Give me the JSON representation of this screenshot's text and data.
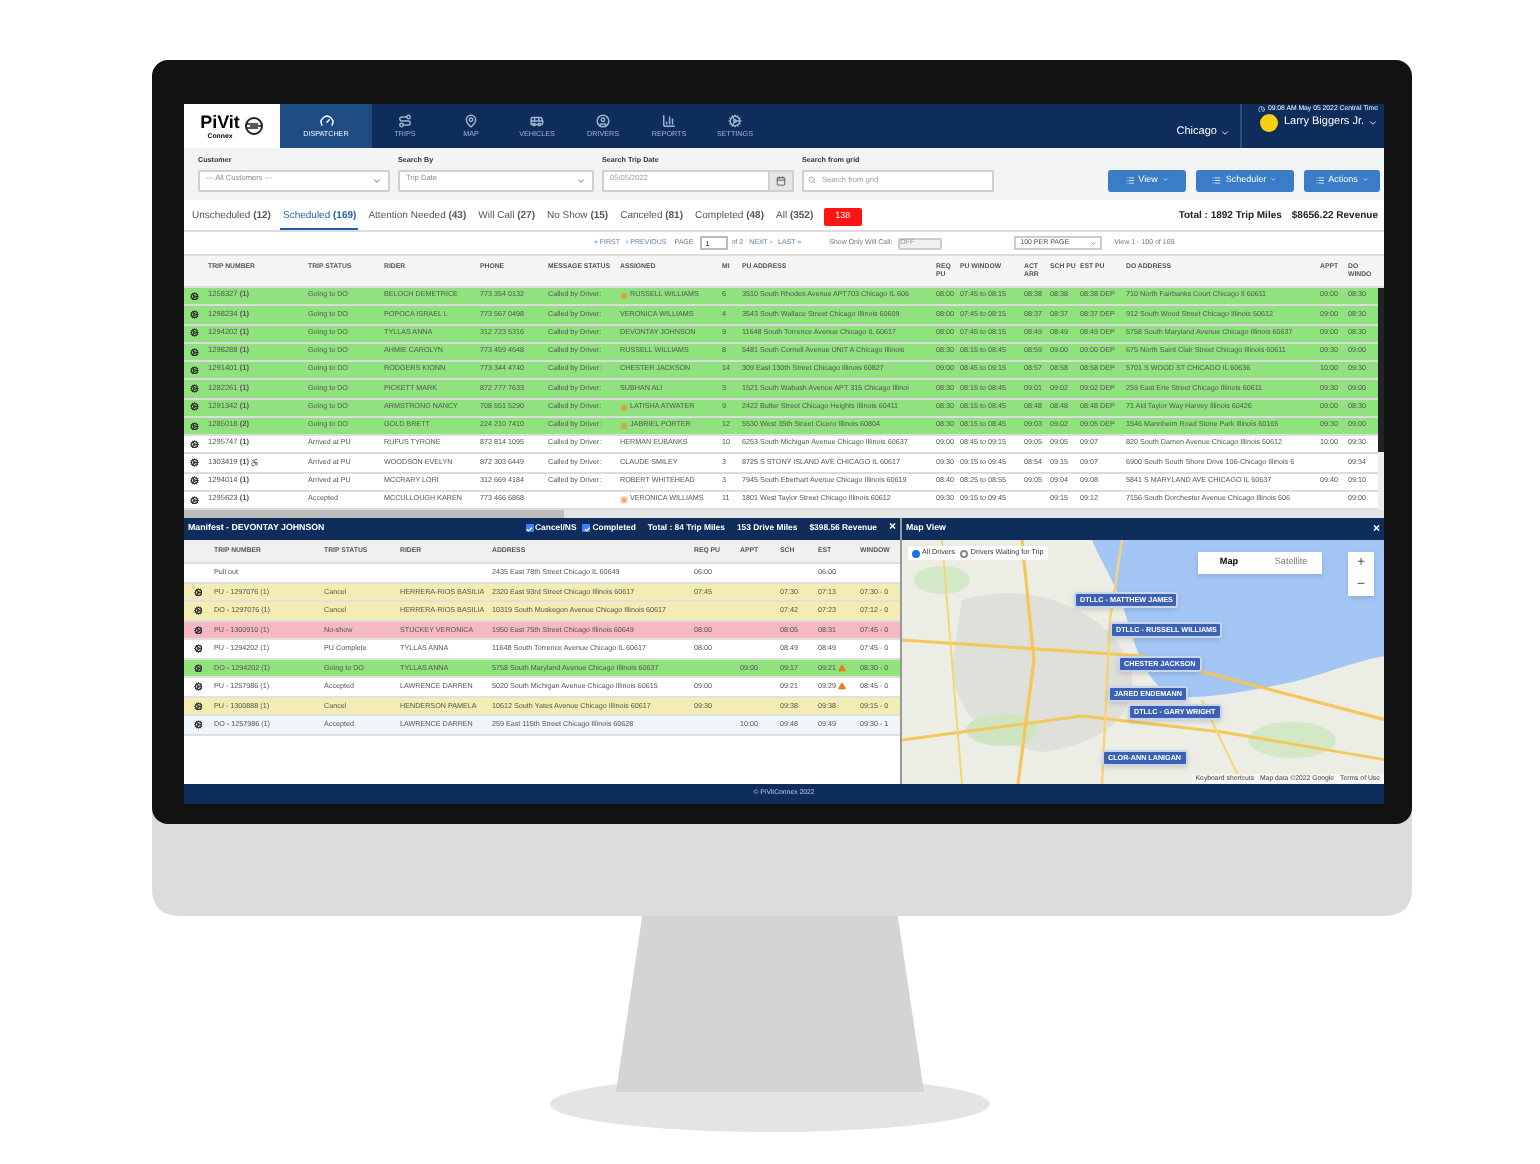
{
  "header": {
    "logo": {
      "name": "PiVit",
      "sub": "Connex"
    },
    "nav": [
      {
        "label": "DISPATCHER",
        "selected": true
      },
      {
        "label": "TRIPS",
        "selected": false
      },
      {
        "label": "MAP",
        "selected": false
      },
      {
        "label": "VEHICLES",
        "selected": false
      },
      {
        "label": "DRIVERS",
        "selected": false
      },
      {
        "label": "REPORTS",
        "selected": false
      },
      {
        "label": "SETTINGS",
        "selected": false
      }
    ],
    "datetime": "09:08 AM May 05 2022 Central Time",
    "city": "Chicago",
    "user": "Larry Biggers Jr."
  },
  "filters": [
    {
      "kind": "select",
      "label": "Customer",
      "value": "--- All Customers ---"
    },
    {
      "kind": "select",
      "label": "Search By",
      "value": "Trip Date"
    },
    {
      "kind": "date",
      "label": "Search Trip Date",
      "value": "05/05/2022"
    },
    {
      "kind": "search",
      "label": "Search from grid",
      "placeholder": "Search from grid"
    }
  ],
  "actions": [
    "View",
    "Scheduler",
    "Actions"
  ],
  "tabs": [
    {
      "label": "Unscheduled **(12)**",
      "selected": false
    },
    {
      "label": "Scheduled **(169)**",
      "selected": true
    },
    {
      "label": "Attention Needed **(43)**",
      "selected": false
    },
    {
      "label": "Will Call **(27)**",
      "selected": false
    },
    {
      "label": "No Show **(15)**",
      "selected": false
    },
    {
      "label": "Canceled **(81)**",
      "selected": false
    },
    {
      "label": "Completed **(48)**",
      "selected": false
    },
    {
      "label": "All **(352)**",
      "selected": false
    }
  ],
  "alert_badge": "138",
  "total_miles": "Total : 1892 Trip Miles",
  "total_revenue": "$8656.22 Revenue",
  "pager": {
    "first": "« FIRST",
    "previous": "‹ PREVIOUS",
    "page_label": "PAGE",
    "page": "1",
    "of": "of 2",
    "next": "NEXT ›",
    "last": "LAST »",
    "will_call_label": "Show Only Will Call:",
    "will_call_toggle": "OFF",
    "will_call_on": false,
    "per_page": "100 PER PAGE",
    "view": "View 1 - 100 of 169"
  },
  "trips": {
    "columns": [
      "TRIP NUMBER",
      "TRIP STATUS",
      "RIDER",
      "PHONE",
      "MESSAGE STATUS",
      "ASSIGNED",
      "MI",
      "PU ADDRESS",
      "REQ PU",
      "PU WINDOW",
      "ACT ARR",
      "SCH PU",
      "EST PU",
      "DO ADDRESS",
      "APPT",
      "DO WINDO"
    ],
    "rows": [
      {
        "highlighted": true,
        "wheelchair": false,
        "assigned_flag": true,
        "trip": "1258327 **(1)**",
        "status": "Going to DO",
        "rider": "BELOCH DEMETRICE",
        "phone": "773 354 0132",
        "message": "Called by Driver:",
        "assigned": "RUSSELL WILLIAMS",
        "mi": "6",
        "pu_address": "3510 South Rhodes Avenue APT703 Chicago IL 606",
        "req_pu": "08:00",
        "pu_window": "07:45 to 08:15",
        "act_arr": "08:38",
        "sch_pu": "08:38",
        "est_pu": "08:38 DEP",
        "do_address": "710 North Fairbanks Court Chicago Il 60611",
        "appt": "09:00",
        "do_window": "08:30"
      },
      {
        "highlighted": true,
        "wheelchair": false,
        "assigned_flag": false,
        "trip": "1298234 **(1)**",
        "status": "Going to DO",
        "rider": "POPOCA ISRAEL L",
        "phone": "773 567 0498",
        "message": "Called by Driver:",
        "assigned": "VERONICA WILLIAMS",
        "mi": "4",
        "pu_address": "3543 South Wallace Street Chicago Illinois 60609",
        "req_pu": "08:00",
        "pu_window": "07:45 to 08:15",
        "act_arr": "08:37",
        "sch_pu": "08:37",
        "est_pu": "08:37 DEP",
        "do_address": "912 South Wood Street Chicago Illinois 60612",
        "appt": "09:00",
        "do_window": "08:30"
      },
      {
        "highlighted": true,
        "wheelchair": false,
        "assigned_flag": false,
        "trip": "1294202 **(1)**",
        "status": "Going to DO",
        "rider": "TYLLAS ANNA",
        "phone": "312 723 5316",
        "message": "Called by Driver:",
        "assigned": "DEVONTAY JOHNSON",
        "mi": "9",
        "pu_address": "11648 South Torrence Avenue Chicago IL 60617",
        "req_pu": "08:00",
        "pu_window": "07:45 to 08:15",
        "act_arr": "08:49",
        "sch_pu": "08:49",
        "est_pu": "08:49 DEP",
        "do_address": "5758 South Maryland Avenue Chicago Illinois 60637",
        "appt": "09:00",
        "do_window": "08:30"
      },
      {
        "highlighted": true,
        "wheelchair": false,
        "assigned_flag": false,
        "trip": "1298288 **(1)**",
        "status": "Going to DO",
        "rider": "AHMIE CAROLYN",
        "phone": "773 459 4648",
        "message": "Called by Driver:",
        "assigned": "RUSSELL WILLIAMS",
        "mi": "8",
        "pu_address": "5481 South Cornell Avenue UNIT A Chicago Illinois",
        "req_pu": "08:30",
        "pu_window": "08:15 to 08:45",
        "act_arr": "08:59",
        "sch_pu": "09:00",
        "est_pu": "09:00 DEP",
        "do_address": "675 North Saint Clair Street Chicago Illinois 60611",
        "appt": "09:30",
        "do_window": "09:00"
      },
      {
        "highlighted": true,
        "wheelchair": false,
        "assigned_flag": false,
        "trip": "1291401 **(1)**",
        "status": "Going to DO",
        "rider": "RODGERS KIONN",
        "phone": "773 344 4740",
        "message": "Called by Driver:",
        "assigned": "CHESTER JACKSON",
        "mi": "14",
        "pu_address": "309 East 130th Street Chicago Illinois 60827",
        "req_pu": "09:00",
        "pu_window": "08:45 to 09:15",
        "act_arr": "08:57",
        "sch_pu": "08:58",
        "est_pu": "08:58 DEP",
        "do_address": "5701 S WOOD ST CHICAGO IL 60636",
        "appt": "10:00",
        "do_window": "09:30"
      },
      {
        "highlighted": true,
        "wheelchair": false,
        "assigned_flag": false,
        "trip": "1282261 **(1)**",
        "status": "Going to DO",
        "rider": "PICKETT MARK",
        "phone": "872 777 7633",
        "message": "Called by Driver:",
        "assigned": "SUBHAN ALI",
        "mi": "3",
        "pu_address": "1521 South Wabash Avenue APT 315 Chicago Illinoi",
        "req_pu": "08:30",
        "pu_window": "08:15 to 08:45",
        "act_arr": "09:01",
        "sch_pu": "09:02",
        "est_pu": "09:02 DEP",
        "do_address": "259 East Erie Street Chicago Illinois 60611",
        "appt": "09:30",
        "do_window": "09:00"
      },
      {
        "highlighted": true,
        "wheelchair": false,
        "assigned_flag": true,
        "trip": "1291342 **(1)**",
        "status": "Going to DO",
        "rider": "ARMSTRONG NANCY",
        "phone": "708 551 5290",
        "message": "Called by Driver:",
        "assigned": "LATISHA ATWATER",
        "mi": "9",
        "pu_address": "2422 Butler Street Chicago Heights Illinois 60411",
        "req_pu": "08:30",
        "pu_window": "08:15 to 08:45",
        "act_arr": "08:48",
        "sch_pu": "08:48",
        "est_pu": "08:48 DEP",
        "do_address": "71 Ald Taylor Way Harvey Illinois 60426",
        "appt": "09:00",
        "do_window": "08:30"
      },
      {
        "highlighted": true,
        "wheelchair": false,
        "assigned_flag": true,
        "trip": "1285018 **(2)**",
        "status": "Going to DO",
        "rider": "GOLD BRETT",
        "phone": "224 210 7410",
        "message": "Called by Driver:",
        "assigned": "JABRIEL PORTER",
        "mi": "12",
        "pu_address": "5530 West 35th Street Cicero Illinois 60804",
        "req_pu": "08:30",
        "pu_window": "08:15 to 08:45",
        "act_arr": "09:03",
        "sch_pu": "09:02",
        "est_pu": "09:05 DEP",
        "do_address": "1546 Mannheim Road Stone Park Illinois 60165",
        "appt": "09:30",
        "do_window": "09:00"
      },
      {
        "highlighted": false,
        "wheelchair": false,
        "assigned_flag": false,
        "trip": "1295747 **(1)**",
        "status": "Arrived at PU",
        "rider": "RUFUS TYRONE",
        "phone": "872 814 1095",
        "message": "Called by Driver:",
        "assigned": "HERMAN EUBANKS",
        "mi": "10",
        "pu_address": "6253 South Michigan Avenue Chicago Illinois 60637",
        "req_pu": "09:00",
        "pu_window": "08:45 to 09:15",
        "act_arr": "09:05",
        "sch_pu": "09:05",
        "est_pu": "09:07",
        "do_address": "820 South Damen Avenue Chicago Illinois 60612",
        "appt": "10:00",
        "do_window": "09:30"
      },
      {
        "highlighted": false,
        "wheelchair": true,
        "assigned_flag": false,
        "trip": "1303419 **(1)**",
        "status": "Arrived at PU",
        "rider": "WOODSON EVELYN",
        "phone": "872 303 6449",
        "message": "Called by Driver:",
        "assigned": "CLAUDE SMILEY",
        "mi": "3",
        "pu_address": "8725 S STONY ISLAND AVE CHICAGO IL 60617",
        "req_pu": "09:30",
        "pu_window": "09:15 to 09:45",
        "act_arr": "08:54",
        "sch_pu": "09:15",
        "est_pu": "09:07",
        "do_address": "6900 South South Shore Drive 106-Chicago Illinois 6",
        "do_window": "09:34"
      },
      {
        "highlighted": false,
        "wheelchair": false,
        "assigned_flag": false,
        "trip": "1294014 **(1)**",
        "status": "Arrived at PU",
        "rider": "MCCRARY LORI",
        "phone": "312 669 4184",
        "message": "Called by Driver:",
        "assigned": "ROBERT WHITEHEAD",
        "mi": "3",
        "pu_address": "7945 South Eberhart Avenue Chicago Illinois 60619",
        "req_pu": "08:40",
        "pu_window": "08:25 to 08:55",
        "act_arr": "09:05",
        "sch_pu": "09:04",
        "est_pu": "09:08",
        "do_address": "5841 S MARYLAND AVE CHICAGO IL 60637",
        "appt": "09:40",
        "do_window": "09:10"
      },
      {
        "highlighted": false,
        "wheelchair": false,
        "assigned_flag": true,
        "trip": "1295623 **(1)**",
        "status": "Accepted",
        "rider": "MCCULLOUGH KAREN",
        "phone": "773 466 6868",
        "assigned": "VERONICA WILLIAMS",
        "mi": "11",
        "pu_address": "1801 West Taylor Street Chicago Illinois 60612",
        "req_pu": "09:30",
        "pu_window": "09:15 to 09:45",
        "sch_pu": "09:15",
        "est_pu": "09:12",
        "do_address": "7156 South Dorchester Avenue Chicago Illinois 606",
        "do_window": "09:00"
      }
    ]
  },
  "manifest": {
    "title": "Manifest - DEVONTAY JOHNSON",
    "checks": [
      {
        "label": "Cancel/NS",
        "checked": true
      },
      {
        "label": "Completed",
        "checked": true
      }
    ],
    "totals": [
      "Total : 84 Trip Miles",
      "153 Drive Miles",
      "$398.56 Revenue"
    ],
    "close": "×",
    "columns": [
      "TRIP NUMBER",
      "TRIP STATUS",
      "RIDER",
      "ADDRESS",
      "REQ PU",
      "APPT",
      "SCH",
      "EST",
      "WINDOW"
    ],
    "rows": [
      {
        "color": "#ffffff",
        "gear": false,
        "warning": false,
        "trip": "Pull out",
        "address": "2435 East 78th Street Chicago IL 60649",
        "req_pu": "06:00",
        "est": "06:00"
      },
      {
        "color": "#f3edb3",
        "gear": true,
        "warning": false,
        "trip": "PU - 1297076 (1)",
        "status": "Cancel",
        "rider": "HERRERA-RIOS BASILIA",
        "address": "2320 East 93rd Street Chicago Illinois 60617",
        "req_pu": "07:45",
        "sch": "07:30",
        "est": "07:13",
        "window": "07:30 - 0"
      },
      {
        "color": "#f3edb3",
        "gear": true,
        "warning": false,
        "trip": "DO - 1297076 (1)",
        "status": "Cancel",
        "rider": "HERRERA-RIOS BASILIA",
        "address": "10319 South Muskegon Avenue Chicago Illinois 60617",
        "sch": "07:42",
        "est": "07:23",
        "window": "07:12 - 0"
      },
      {
        "color": "#f6b8c2",
        "gear": true,
        "warning": false,
        "trip": "PU - 1300910 (1)",
        "status": "No-show",
        "rider": "STUCKEY VERONICA",
        "address": "1950 East 75th Street Chicago Illinois 60649",
        "req_pu": "08:00",
        "sch": "08:05",
        "est": "08:31",
        "window": "07:45 - 0"
      },
      {
        "color": "#ffffff",
        "gear": true,
        "warning": false,
        "trip": "PU - 1294202 (1)",
        "status": "PU Complete",
        "rider": "TYLLAS ANNA",
        "address": "11648 South Torrence Avenue Chicago IL 60617",
        "req_pu": "08:00",
        "sch": "08:49",
        "est": "08:49",
        "window": "07:45 - 0"
      },
      {
        "color": "#8fe27c",
        "gear": true,
        "warning": true,
        "trip": "DO - 1294202 (1)",
        "status": "Going to DO",
        "rider": "TYLLAS ANNA",
        "address": "5758 South Maryland Avenue Chicago Illinois 60637",
        "appt": "09:00",
        "sch": "09:17",
        "est": "09:21",
        "window": "08:30 - 0"
      },
      {
        "color": "#ffffff",
        "gear": true,
        "warning": true,
        "trip": "PU - 1257986 (1)",
        "status": "Accepted",
        "rider": "LAWRENCE DARREN",
        "address": "5020 South Michigan Avenue Chicago Illinois 60615",
        "req_pu": "09:00",
        "sch": "09:21",
        "est": "09:29",
        "window": "08:45 - 0"
      },
      {
        "color": "#f3edb3",
        "gear": true,
        "warning": false,
        "trip": "PU - 1300888 (1)",
        "status": "Cancel",
        "rider": "HENDERSON PAMELA",
        "address": "10612 South Yates Avenue Chicago Illinois 60617",
        "req_pu": "09:30",
        "sch": "09:38",
        "est": "09:38",
        "window": "09:15 - 0"
      },
      {
        "color": "#eef6fc",
        "gear": true,
        "warning": false,
        "trip": "DO - 1257986 (1)",
        "status": "Accepted",
        "rider": "LAWRENCE DARREN",
        "address": "259 East 115th Street Chicago Illinois 60628",
        "appt": "10:00",
        "sch": "09:48",
        "est": "09:49",
        "window": "09:30 - 1"
      }
    ]
  },
  "map": {
    "title": "Map View",
    "close": "×",
    "filters": [
      {
        "label": "All Drivers",
        "selected": true
      },
      {
        "label": "Drivers Waiting for Trip",
        "selected": false
      }
    ],
    "map_types": [
      {
        "label": "Map",
        "selected": true
      },
      {
        "label": "Satellite",
        "selected": false
      }
    ],
    "zoom_in": "+",
    "zoom_out": "−",
    "drivers": [
      "DTLLC - MATTHEW JAMES",
      "DTLLC - RUSSELL WILLIAMS",
      "CHESTER JACKSON",
      "JARED ENDEMANN",
      "DTLLC - GARY WRIGHT",
      "CLOR-ANN LANIGAN"
    ],
    "attribution": [
      "Keyboard shortcuts",
      "Map data ©2022 Google",
      "Terms of Use"
    ]
  },
  "footer": "© PiVitConnex 2022"
}
